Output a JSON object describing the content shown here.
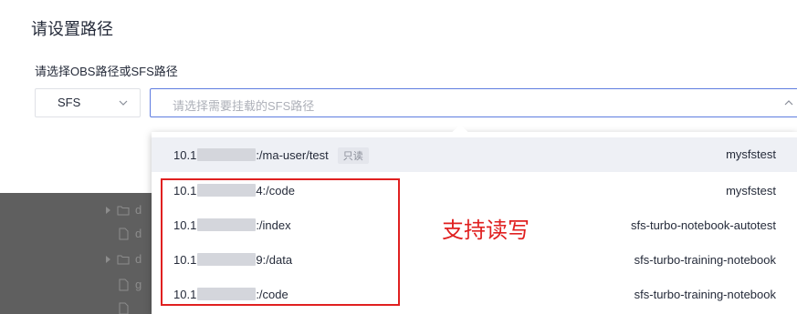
{
  "title": "请设置路径",
  "path_label": "请选择OBS路径或SFS路径",
  "type_select": {
    "value": "SFS"
  },
  "path_input": {
    "placeholder": "请选择需要挂载的SFS路径"
  },
  "tree_items": [
    {
      "icon": "folder-icon",
      "label": "d"
    },
    {
      "icon": "file-icon",
      "label": "d"
    },
    {
      "icon": "folder-icon",
      "label": "d"
    },
    {
      "icon": "file-icon",
      "label": "g"
    },
    {
      "icon": "file-icon",
      "label": ""
    }
  ],
  "options": [
    {
      "prefix": "10.1",
      "path": ":/ma-user/test",
      "badge": "只读",
      "owner": "mysfstest"
    },
    {
      "prefix": "10.1",
      "path": "4:/code",
      "badge": "",
      "owner": "mysfstest"
    },
    {
      "prefix": "10.1",
      "path": ":/index",
      "badge": "",
      "owner": "sfs-turbo-notebook-autotest"
    },
    {
      "prefix": "10.1",
      "path": "9:/data",
      "badge": "",
      "owner": "sfs-turbo-training-notebook"
    },
    {
      "prefix": "10.1",
      "path": ":/code",
      "badge": "",
      "owner": "sfs-turbo-training-notebook"
    }
  ],
  "annotation": "支持读写",
  "colors": {
    "accent": "#5e7ce0",
    "annotation": "#e02020",
    "hover": "#eef0f5"
  }
}
